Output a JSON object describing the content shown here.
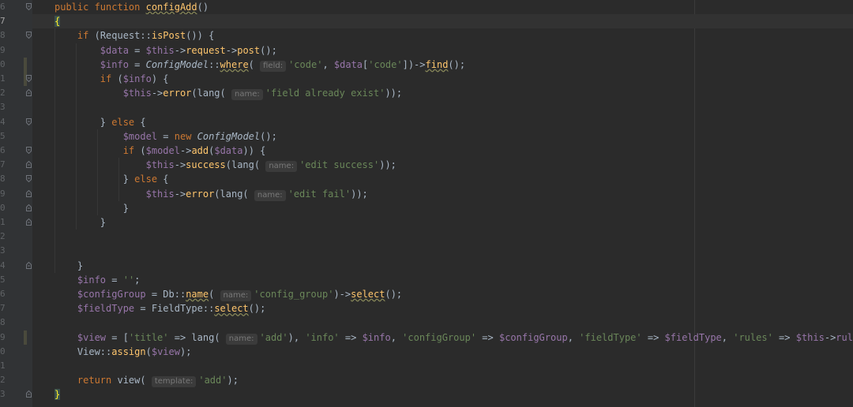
{
  "editor": {
    "line_numbers": [
      "6",
      "7",
      "8",
      "9",
      "0",
      "1",
      "2",
      "3",
      "4",
      "5",
      "6",
      "7",
      "8",
      "9",
      "0",
      "1",
      "2",
      "3",
      "4",
      "5",
      "6",
      "7",
      "8",
      "9",
      "0",
      "1",
      "2",
      "3"
    ],
    "lines": [
      {
        "parts": [
          [
            "kw",
            "public function "
          ],
          [
            "fnu",
            "configAdd"
          ],
          [
            "p",
            "()"
          ]
        ]
      },
      {
        "parts": [
          [
            "brace",
            "{"
          ]
        ]
      },
      {
        "parts": [
          [
            "p",
            "    "
          ],
          [
            "kw",
            "if "
          ],
          [
            "p",
            "(Request::"
          ],
          [
            "fn",
            "isPost"
          ],
          [
            "p",
            "()) {"
          ]
        ]
      },
      {
        "parts": [
          [
            "p",
            "        "
          ],
          [
            "var",
            "$data"
          ],
          [
            "p",
            " = "
          ],
          [
            "var",
            "$this"
          ],
          [
            "p",
            "->"
          ],
          [
            "fn",
            "request"
          ],
          [
            "p",
            "->"
          ],
          [
            "fn",
            "post"
          ],
          [
            "p",
            "();"
          ]
        ]
      },
      {
        "parts": [
          [
            "p",
            "        "
          ],
          [
            "var",
            "$info"
          ],
          [
            "p",
            " = "
          ],
          [
            "cls",
            "ConfigModel"
          ],
          [
            "p",
            "::"
          ],
          [
            "fnu",
            "where"
          ],
          [
            "p",
            "( "
          ],
          [
            "hint",
            "field:"
          ],
          [
            "str",
            "'code'"
          ],
          [
            "p",
            ", "
          ],
          [
            "var",
            "$data"
          ],
          [
            "p",
            "["
          ],
          [
            "str",
            "'code'"
          ],
          [
            "p",
            "])->"
          ],
          [
            "fnu",
            "find"
          ],
          [
            "p",
            "();"
          ]
        ]
      },
      {
        "parts": [
          [
            "p",
            "        "
          ],
          [
            "kw",
            "if "
          ],
          [
            "p",
            "("
          ],
          [
            "var",
            "$info"
          ],
          [
            "p",
            ") {"
          ]
        ]
      },
      {
        "parts": [
          [
            "p",
            "            "
          ],
          [
            "var",
            "$this"
          ],
          [
            "p",
            "->"
          ],
          [
            "fn",
            "error"
          ],
          [
            "p",
            "(lang( "
          ],
          [
            "hint",
            "name:"
          ],
          [
            "str",
            "'field already exist'"
          ],
          [
            "p",
            "));"
          ]
        ]
      },
      {
        "parts": []
      },
      {
        "parts": [
          [
            "p",
            "        } "
          ],
          [
            "kw",
            "else "
          ],
          [
            "p",
            "{"
          ]
        ]
      },
      {
        "parts": [
          [
            "p",
            "            "
          ],
          [
            "var",
            "$model"
          ],
          [
            "p",
            " = "
          ],
          [
            "kw",
            "new "
          ],
          [
            "cls",
            "ConfigModel"
          ],
          [
            "p",
            "();"
          ]
        ]
      },
      {
        "parts": [
          [
            "p",
            "            "
          ],
          [
            "kw",
            "if "
          ],
          [
            "p",
            "("
          ],
          [
            "var",
            "$model"
          ],
          [
            "p",
            "->"
          ],
          [
            "fn",
            "add"
          ],
          [
            "p",
            "("
          ],
          [
            "var",
            "$data"
          ],
          [
            "p",
            ")) {"
          ]
        ]
      },
      {
        "parts": [
          [
            "p",
            "                "
          ],
          [
            "var",
            "$this"
          ],
          [
            "p",
            "->"
          ],
          [
            "fn",
            "success"
          ],
          [
            "p",
            "(lang( "
          ],
          [
            "hint",
            "name:"
          ],
          [
            "str",
            "'edit success'"
          ],
          [
            "p",
            "));"
          ]
        ]
      },
      {
        "parts": [
          [
            "p",
            "            } "
          ],
          [
            "kw",
            "else "
          ],
          [
            "p",
            "{"
          ]
        ]
      },
      {
        "parts": [
          [
            "p",
            "                "
          ],
          [
            "var",
            "$this"
          ],
          [
            "p",
            "->"
          ],
          [
            "fn",
            "error"
          ],
          [
            "p",
            "(lang( "
          ],
          [
            "hint",
            "name:"
          ],
          [
            "str",
            "'edit fail'"
          ],
          [
            "p",
            "));"
          ]
        ]
      },
      {
        "parts": [
          [
            "p",
            "            }"
          ]
        ]
      },
      {
        "parts": [
          [
            "p",
            "        }"
          ]
        ]
      },
      {
        "parts": []
      },
      {
        "parts": []
      },
      {
        "parts": [
          [
            "p",
            "    }"
          ]
        ]
      },
      {
        "parts": [
          [
            "p",
            "    "
          ],
          [
            "var",
            "$info"
          ],
          [
            "p",
            " = "
          ],
          [
            "str",
            "''"
          ],
          [
            "p",
            ";"
          ]
        ]
      },
      {
        "parts": [
          [
            "p",
            "    "
          ],
          [
            "var",
            "$configGroup"
          ],
          [
            "p",
            " = Db::"
          ],
          [
            "fnu",
            "name"
          ],
          [
            "p",
            "( "
          ],
          [
            "hint",
            "name:"
          ],
          [
            "str",
            "'config_group'"
          ],
          [
            "p",
            ")->"
          ],
          [
            "fnu",
            "select"
          ],
          [
            "p",
            "();"
          ]
        ]
      },
      {
        "parts": [
          [
            "p",
            "    "
          ],
          [
            "var",
            "$fieldType"
          ],
          [
            "p",
            " = FieldType::"
          ],
          [
            "fnu",
            "select"
          ],
          [
            "p",
            "();"
          ]
        ]
      },
      {
        "parts": []
      },
      {
        "parts": [
          [
            "p",
            "    "
          ],
          [
            "var",
            "$view"
          ],
          [
            "p",
            " = ["
          ],
          [
            "str",
            "'title'"
          ],
          [
            "p",
            " => lang( "
          ],
          [
            "hint",
            "name:"
          ],
          [
            "str",
            "'add'"
          ],
          [
            "p",
            "), "
          ],
          [
            "str",
            "'info'"
          ],
          [
            "p",
            " => "
          ],
          [
            "var",
            "$info"
          ],
          [
            "p",
            ", "
          ],
          [
            "str",
            "'configGroup'"
          ],
          [
            "p",
            " => "
          ],
          [
            "var",
            "$configGroup"
          ],
          [
            "p",
            ", "
          ],
          [
            "str",
            "'fieldType'"
          ],
          [
            "p",
            " => "
          ],
          [
            "var",
            "$fieldType"
          ],
          [
            "p",
            ", "
          ],
          [
            "str",
            "'rules'"
          ],
          [
            "p",
            " => "
          ],
          [
            "var",
            "$this"
          ],
          [
            "p",
            "->"
          ],
          [
            "var",
            "rules"
          ],
          [
            "p",
            "];"
          ]
        ]
      },
      {
        "parts": [
          [
            "p",
            "    View::"
          ],
          [
            "fn",
            "assign"
          ],
          [
            "p",
            "("
          ],
          [
            "var",
            "$view"
          ],
          [
            "p",
            ");"
          ]
        ]
      },
      {
        "parts": []
      },
      {
        "parts": [
          [
            "p",
            "    "
          ],
          [
            "kw",
            "return "
          ],
          [
            "p",
            "view( "
          ],
          [
            "hint",
            "template:"
          ],
          [
            "str",
            "'add'"
          ],
          [
            "p",
            ");"
          ]
        ]
      },
      {
        "parts": [
          [
            "brace",
            "}"
          ]
        ]
      }
    ],
    "current_line_index": 1,
    "fold_markers": {
      "0": "open",
      "2": "open",
      "5": "open",
      "6": "close",
      "8": "open",
      "10": "open",
      "11": "close",
      "12": "open",
      "13": "close",
      "14": "close",
      "15": "close",
      "18": "close",
      "27": "close"
    },
    "change_marks": [
      4,
      5,
      23
    ]
  }
}
